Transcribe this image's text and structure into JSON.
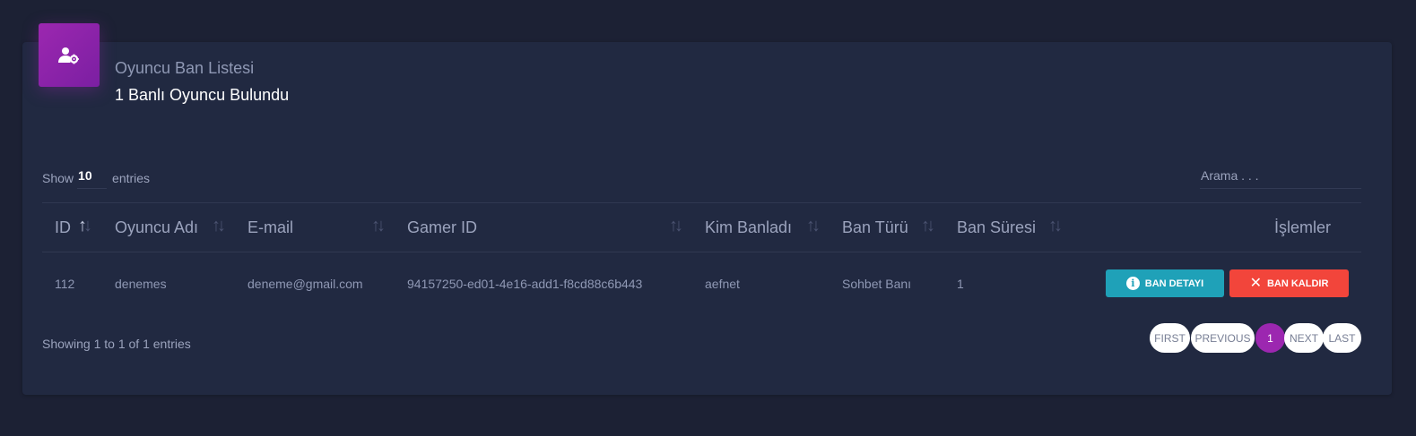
{
  "header": {
    "icon": "user-gear-icon",
    "title": "Oyuncu Ban Listesi",
    "subtitle": "1 Banlı Oyuncu Bulundu",
    "accent_color": "#9c27b0"
  },
  "length_menu": {
    "prefix": "Show",
    "value": "10",
    "suffix": "entries"
  },
  "search": {
    "placeholder": "Arama . . ."
  },
  "table": {
    "columns": [
      {
        "label": "ID",
        "sort": "asc"
      },
      {
        "label": "Oyuncu Adı",
        "sort": "both"
      },
      {
        "label": "E-mail",
        "sort": "both"
      },
      {
        "label": "Gamer ID",
        "sort": "both"
      },
      {
        "label": "Kim Banladı",
        "sort": "both"
      },
      {
        "label": "Ban Türü",
        "sort": "both"
      },
      {
        "label": "Ban Süresi",
        "sort": "both"
      },
      {
        "label": "İşlemler",
        "sort": "none"
      }
    ],
    "rows": [
      {
        "id": "112",
        "player_name": "denemes",
        "email": "deneme@gmail.com",
        "gamer_id": "94157250-ed01-4e16-add1-f8cd88c6b443",
        "banned_by": "aefnet",
        "ban_type": "Sohbet Banı",
        "ban_duration": "1",
        "actions": {
          "detail_label": "BAN DETAYI",
          "detail_icon": "info-icon",
          "detail_color": "#1fa1b8",
          "remove_label": "BAN KALDIR",
          "remove_icon": "close-icon",
          "remove_color": "#f2453b"
        }
      }
    ]
  },
  "footer": {
    "info": "Showing 1 to 1 of 1 entries"
  },
  "pagination": {
    "first": "FIRST",
    "previous": "PREVIOUS",
    "current": "1",
    "next": "NEXT",
    "last": "LAST"
  }
}
